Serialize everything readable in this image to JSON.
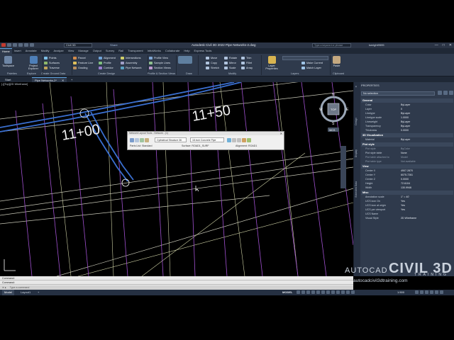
{
  "titlebar": {
    "workspace": "Civil 3D",
    "share": "Share",
    "title": "Autodesk Civil 3D 2022   Pipe Networks-2.dwg",
    "search_placeholder": "Type a keyword or phrase",
    "user": "kwright9595",
    "win_min": "—",
    "win_max": "□",
    "win_close": "✕"
  },
  "ribbon_tabs": [
    "Home",
    "Insert",
    "Annotate",
    "Modify",
    "Analyze",
    "View",
    "Manage",
    "Output",
    "Survey",
    "Rail",
    "Transparent",
    "InfraWorks",
    "Collaborate",
    "Help",
    "Express Tools"
  ],
  "ribbon": {
    "toolspace": "Toolspace",
    "project_explorer": "Project Explorer",
    "points": "Points",
    "surfaces": "Surfaces",
    "traverse": "Traverse",
    "parcel": "Parcel",
    "feature_line": "Feature Line",
    "grading": "Grading",
    "alignment": "Alignment",
    "profile": "Profile",
    "corridor": "Corridor",
    "intersections": "Intersections",
    "assembly": "Assembly",
    "pipe_network": "Pipe Network",
    "profile_view": "Profile View",
    "sample_lines": "Sample Lines",
    "section_views": "Section Views",
    "move": "Move",
    "copy": "Copy",
    "stretch": "Stretch",
    "rotate": "Rotate",
    "mirror": "Mirror",
    "scale": "Scale",
    "trim": "Trim",
    "fillet": "Fillet",
    "array": "Array",
    "layer_properties": "Layer Properties",
    "make_current": "Make Current",
    "match_layer": "Match Layer",
    "paste": "Paste",
    "panel_palettes": "Palettes",
    "panel_explore": "Explore",
    "panel_ground": "Create Ground Data",
    "panel_design": "Create Design",
    "panel_profile_section": "Profile & Section Views",
    "panel_draw": "Draw",
    "panel_modify": "Modify",
    "panel_layers": "Layers",
    "panel_clipboard": "Clipboard"
  },
  "doc_tabs": {
    "start": "Start",
    "doc": "Pipe Networks-2*",
    "close": "✕",
    "add": "+"
  },
  "viewport_label": "[-][Top][2D Wireframe]",
  "drawing": {
    "station1": "11+00",
    "station2": "11+50",
    "compass": {
      "n": "N",
      "s": "S",
      "e": "E",
      "w": "W",
      "top": "TOP",
      "wcs": "WCS"
    }
  },
  "pipetool": {
    "title": "Network Layout Tools - Network - (1)",
    "structure": "Cylindrical Structure 36",
    "pipe": "18 inch Concrete Pipe",
    "parts_list": "Parts List: Standard",
    "surface": "Surface: ROAD1_SURF",
    "alignment": "Alignment: ROAD1",
    "close": "✕"
  },
  "properties": {
    "title": "PROPERTIES",
    "selection": "No selection",
    "side_tabs": [
      "Design",
      "Display",
      "Extended Data",
      "Extended Data"
    ],
    "sections": [
      {
        "name": "General",
        "rows": [
          [
            "Color",
            "ByLayer"
          ],
          [
            "Layer",
            "0"
          ],
          [
            "Linetype",
            "ByLayer"
          ],
          [
            "Linetype scale",
            "1.0000"
          ],
          [
            "Lineweight",
            "ByLayer"
          ],
          [
            "Transparency",
            "ByLayer"
          ],
          [
            "Thickness",
            "0.0000"
          ]
        ]
      },
      {
        "name": "3D Visualization",
        "rows": [
          [
            "Material",
            "ByLayer"
          ]
        ]
      },
      {
        "name": "Plot style",
        "rows": [
          [
            "Plot style",
            "ByColor"
          ],
          [
            "Plot style table",
            "None"
          ],
          [
            "Plot table attached to",
            "Model"
          ],
          [
            "Plot table type",
            "Not available"
          ]
        ]
      },
      {
        "name": "View",
        "rows": [
          [
            "Center X",
            "4907.2870"
          ],
          [
            "Center Y",
            "6075.7261"
          ],
          [
            "Center Z",
            "0.0000"
          ],
          [
            "Height",
            "72.6104"
          ],
          [
            "Width",
            "130.9946"
          ]
        ]
      },
      {
        "name": "Misc",
        "rows": [
          [
            "Annotation scale",
            "1\" = 40'"
          ],
          [
            "UCS icon On",
            "Yes"
          ],
          [
            "UCS icon at origin",
            "Yes"
          ],
          [
            "UCS per viewport",
            "Yes"
          ],
          [
            "UCS Name",
            ""
          ],
          [
            "Visual Style",
            "2D Wireframe"
          ]
        ]
      }
    ]
  },
  "watermark": {
    "line1": "AUTOCAD",
    "line2": "CIVIL 3D",
    "line3": "TRAINING",
    "line4": "autocadcivil3dtraining.com"
  },
  "command": {
    "hist1": "Command:",
    "hist2": "Command:",
    "placeholder": "Type a command",
    "prompt": "✕  ▸"
  },
  "status": {
    "model": "Model",
    "layout1": "Layout1",
    "add": "+",
    "model_btn": "MODEL",
    "scale": "1:500"
  }
}
